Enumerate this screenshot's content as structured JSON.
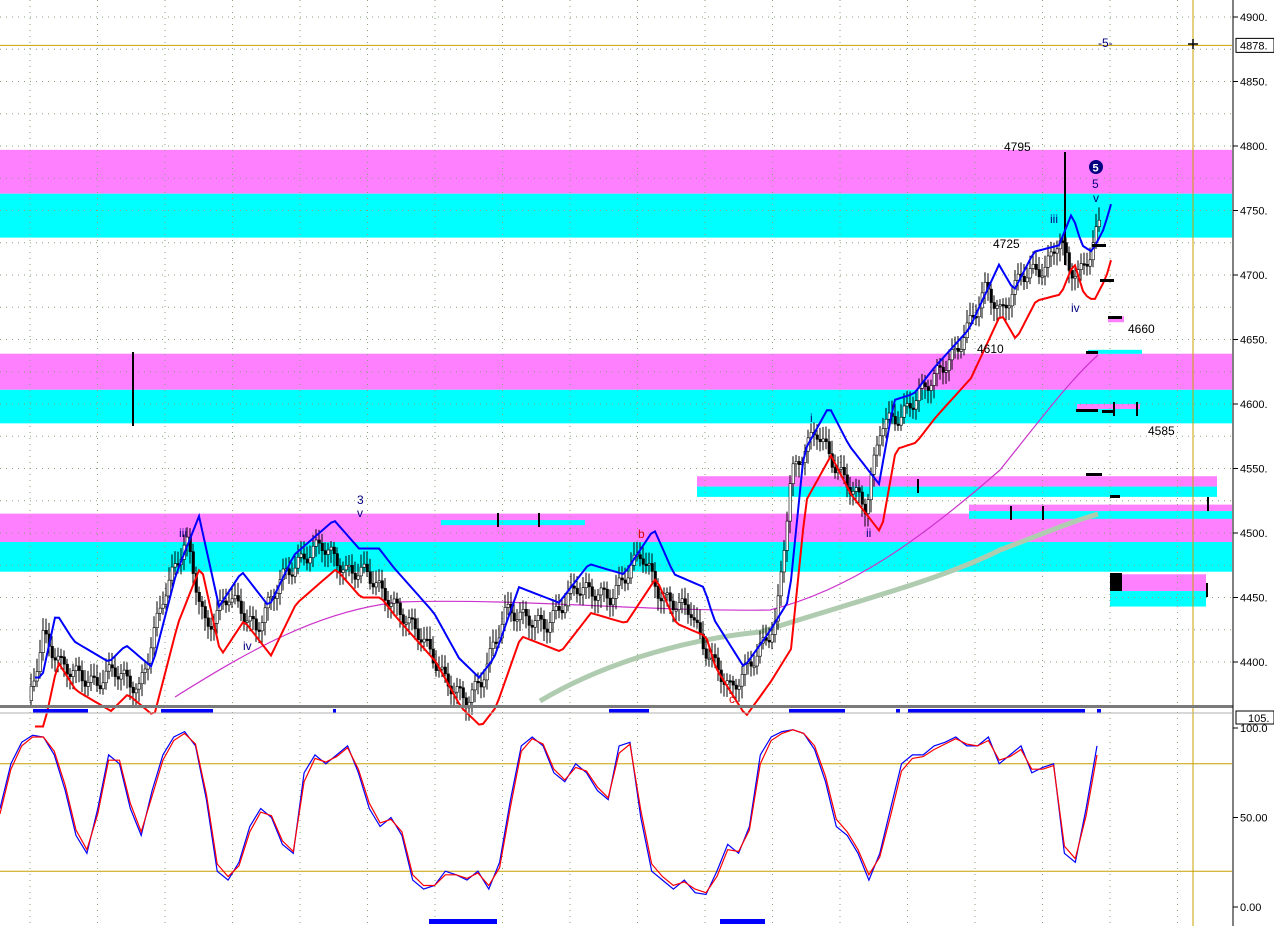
{
  "colors": {
    "magenta_zone": "#ff80ff",
    "cyan_zone": "#00ffff",
    "grid": "#8aa07a",
    "crosshair": "#c8a000",
    "blue": "#0000ff",
    "red": "#ff0000",
    "ma_magenta": "#cc33cc",
    "ma_gray": "#b0ccb0",
    "navy": "#000080",
    "wave_red": "#dd0000"
  },
  "price_axis": {
    "ticks": [
      "4900.",
      "4850.",
      "4800.",
      "4750.",
      "4700.",
      "4650.",
      "4600.",
      "4550.",
      "4500.",
      "4450.",
      "4400."
    ],
    "crosshair_label": "4878.",
    "crosshair_value": 4878
  },
  "osc_axis": {
    "ticks": [
      "100.0",
      "50.00",
      "0.00"
    ],
    "top_label": "105."
  },
  "chart_data": [
    {
      "type": "candlestick",
      "ylim": [
        4360,
        4910
      ],
      "horizontal_levels": [
        "4795",
        "4725",
        "4660",
        "4610",
        "4585"
      ],
      "support_resistance_zones": [
        {
          "top": 4797,
          "bottom": 4729,
          "split": 4763
        },
        {
          "top": 4639,
          "bottom": 4585,
          "split": 4611
        },
        {
          "top": 4515,
          "bottom": 4470,
          "split": 4493
        },
        {
          "top": 4544,
          "bottom": 4528,
          "split": 4536
        },
        {
          "top": 4522,
          "bottom": 4511,
          "split": 4517
        },
        {
          "top": 4468,
          "bottom": 4443,
          "split": 4455
        }
      ],
      "wave_labels": [
        {
          "text": "iii",
          "color": "navy"
        },
        {
          "text": "iv",
          "color": "navy"
        },
        {
          "text": "3",
          "color": "navy"
        },
        {
          "text": "v",
          "color": "navy"
        },
        {
          "text": "b",
          "color": "wave_red"
        },
        {
          "text": "c",
          "color": "wave_red"
        },
        {
          "text": "i",
          "color": "navy"
        },
        {
          "text": "ii",
          "color": "navy"
        },
        {
          "text": "iii",
          "color": "navy"
        },
        {
          "text": "iv",
          "color": "navy"
        },
        {
          "text": "5",
          "color": "navy"
        },
        {
          "text": "v",
          "color": "navy"
        },
        {
          "text": "-5-",
          "color": "navy"
        }
      ],
      "circled_label": "5"
    },
    {
      "type": "line",
      "ylim": [
        0,
        105
      ],
      "reference_lines": [
        20,
        80
      ],
      "series": [
        {
          "color": "blue",
          "values": [
            55,
            80,
            92,
            96,
            95,
            85,
            65,
            40,
            30,
            55,
            85,
            80,
            55,
            40,
            65,
            85,
            95,
            98,
            90,
            60,
            20,
            15,
            25,
            45,
            55,
            50,
            35,
            30,
            75,
            85,
            80,
            85,
            90,
            75,
            55,
            45,
            50,
            40,
            15,
            10,
            12,
            20,
            18,
            15,
            20,
            10,
            25,
            60,
            90,
            95,
            90,
            75,
            70,
            80,
            75,
            65,
            60,
            90,
            92,
            50,
            20,
            15,
            10,
            15,
            8,
            7,
            20,
            35,
            30,
            45,
            85,
            95,
            98,
            99,
            97,
            88,
            70,
            45,
            40,
            30,
            15,
            30,
            55,
            80,
            85,
            85,
            90,
            92,
            95,
            90,
            90,
            95,
            80,
            85,
            90,
            75,
            78,
            80,
            30,
            25,
            55,
            90
          ]
        },
        {
          "color": "red",
          "values": [
            52,
            77,
            90,
            95,
            95,
            87,
            68,
            43,
            32,
            52,
            82,
            82,
            58,
            42,
            62,
            82,
            93,
            97,
            91,
            63,
            24,
            17,
            23,
            42,
            53,
            51,
            37,
            31,
            70,
            83,
            81,
            84,
            89,
            77,
            58,
            47,
            49,
            42,
            18,
            12,
            12,
            18,
            18,
            16,
            19,
            12,
            22,
            56,
            87,
            94,
            91,
            77,
            71,
            78,
            76,
            67,
            61,
            86,
            91,
            54,
            24,
            17,
            12,
            14,
            10,
            8,
            17,
            32,
            31,
            43,
            80,
            93,
            97,
            99,
            97,
            90,
            73,
            49,
            42,
            32,
            18,
            28,
            51,
            76,
            83,
            84,
            88,
            91,
            94,
            91,
            90,
            93,
            82,
            84,
            88,
            77,
            77,
            79,
            34,
            27,
            51,
            85
          ]
        }
      ]
    }
  ]
}
